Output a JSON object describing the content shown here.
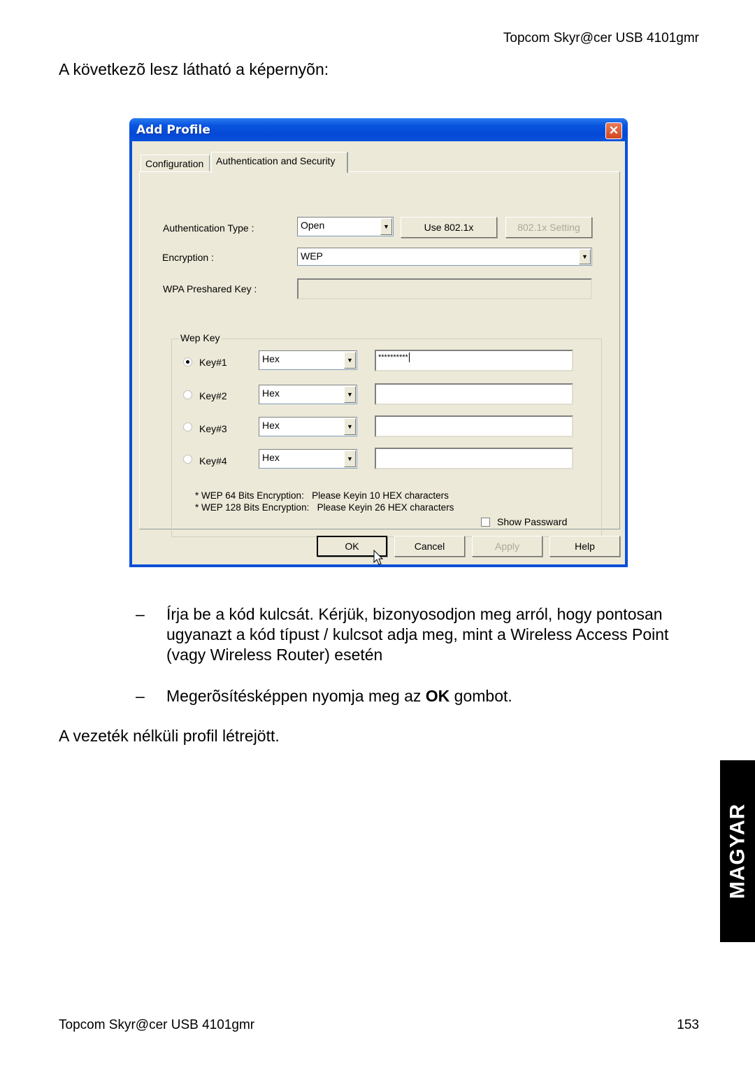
{
  "page": {
    "header": "Topcom Skyr@cer USB 4101gmr",
    "intro": "A következõ lesz látható a képernyõn:",
    "bullets": [
      {
        "dash": "–",
        "text_before": "Írja be a kód kulcsát. Kérjük, bizonyosodjon meg arról, hogy pontosan ugyanazt a kód típust / kulcsot adja meg, mint a Wireless Access Point (vagy Wireless Router) esetén",
        "bold": "",
        "text_after": ""
      },
      {
        "dash": "–",
        "text_before": "Megerõsítésképpen nyomja meg az ",
        "bold": "OK",
        "text_after": " gombot."
      }
    ],
    "outro": "A vezeték nélküli profil létrejött.",
    "footer_left": "Topcom Skyr@cer USB 4101gmr",
    "page_number": "153",
    "language_tab": "MAGYAR"
  },
  "dialog": {
    "title": "Add Profile",
    "close_glyph": "✕",
    "tabs": [
      {
        "label": "Configuration",
        "active": false
      },
      {
        "label": "Authentication and Security",
        "active": true
      }
    ],
    "auth_type_label": "Authentication Type :",
    "auth_type_value": "Open",
    "use_8021x_label": "Use 802.1x",
    "setting_8021x_label": "802.1x Setting",
    "encryption_label": "Encryption :",
    "encryption_value": "WEP",
    "wpa_label": "WPA Preshared Key :",
    "wpa_value": "",
    "wep_group_label": "Wep Key",
    "keys": [
      {
        "label": "Key#1",
        "selected": true,
        "format": "Hex",
        "value": "**********"
      },
      {
        "label": "Key#2",
        "selected": false,
        "format": "Hex",
        "value": ""
      },
      {
        "label": "Key#3",
        "selected": false,
        "format": "Hex",
        "value": ""
      },
      {
        "label": "Key#4",
        "selected": false,
        "format": "Hex",
        "value": ""
      }
    ],
    "notes": [
      "* WEP 64 Bits Encryption:   Please Keyin 10 HEX characters",
      "* WEP 128 Bits Encryption:   Please Keyin 26 HEX characters"
    ],
    "show_password_label": "Show Passward",
    "show_password_checked": false,
    "buttons": {
      "ok": "OK",
      "cancel": "Cancel",
      "apply": "Apply",
      "help": "Help"
    },
    "dropdown_arrow": "▼"
  }
}
